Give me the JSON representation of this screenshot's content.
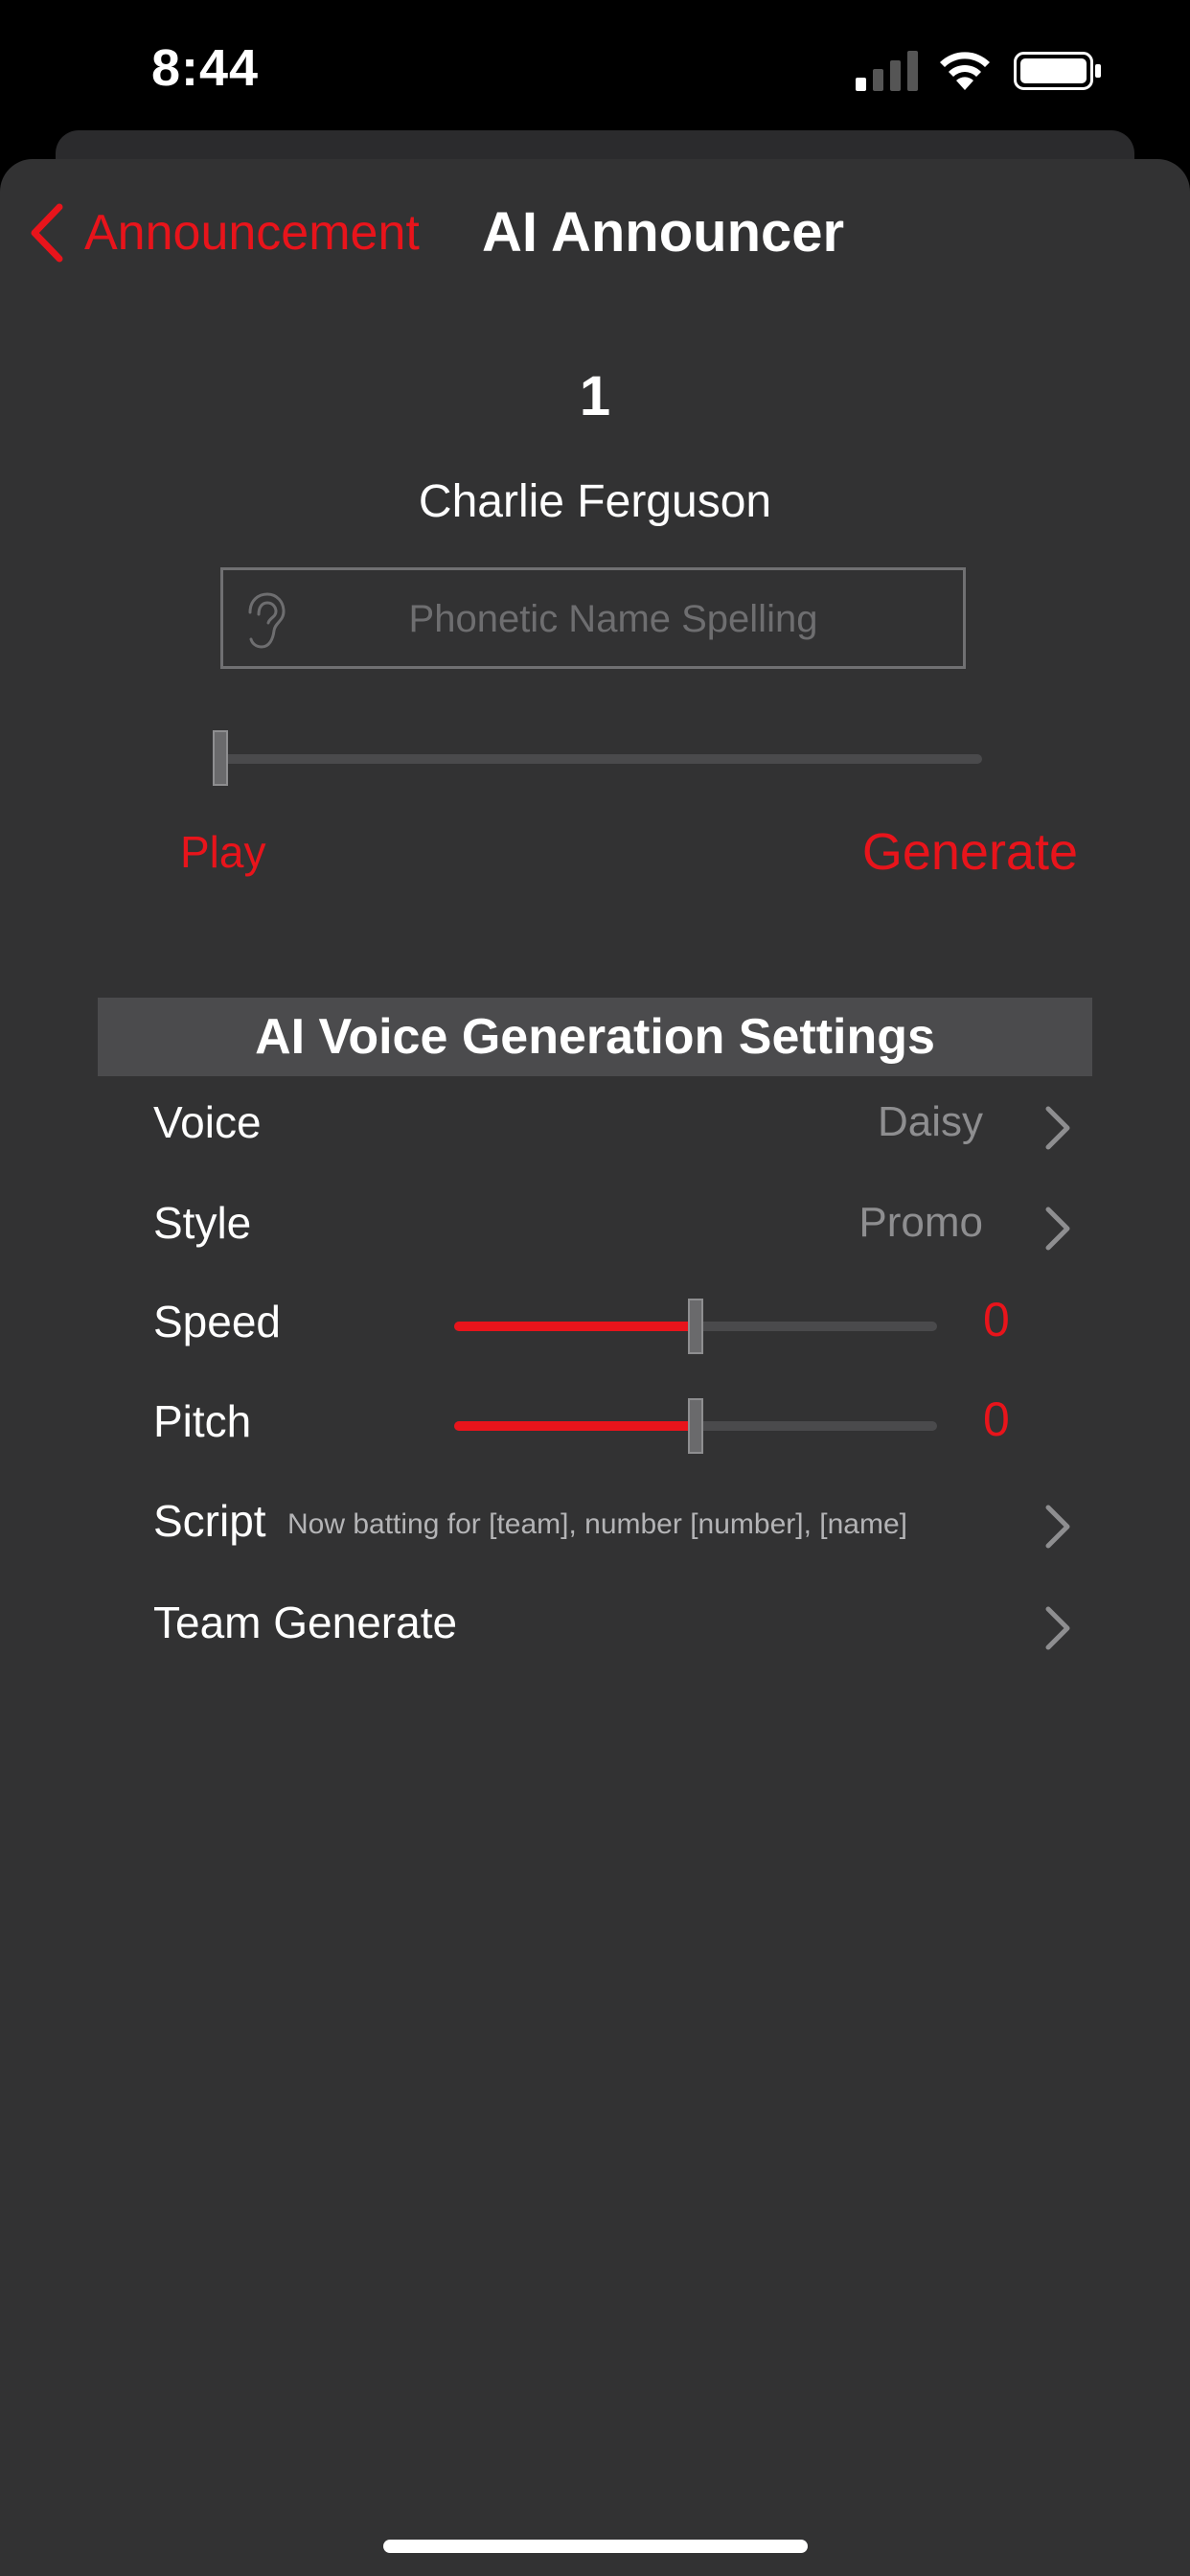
{
  "status_bar": {
    "time": "8:44"
  },
  "nav": {
    "back_label": "Announcement",
    "title": "AI Announcer"
  },
  "player": {
    "number": "1",
    "name": "Charlie Ferguson",
    "phonetic_placeholder": "Phonetic Name Spelling",
    "phonetic_value": ""
  },
  "playback": {
    "progress": 0,
    "play_label": "Play",
    "generate_label": "Generate"
  },
  "settings": {
    "header": "AI Voice Generation Settings",
    "voice": {
      "label": "Voice",
      "value": "Daisy"
    },
    "style": {
      "label": "Style",
      "value": "Promo"
    },
    "speed": {
      "label": "Speed",
      "value": "0",
      "level": 0.5
    },
    "pitch": {
      "label": "Pitch",
      "value": "0",
      "level": 0.5
    },
    "script": {
      "label": "Script",
      "value": "Now batting for [team], number [number], [name]"
    },
    "team_generate": {
      "label": "Team Generate"
    }
  },
  "colors": {
    "accent": "#e8141b",
    "background": "#323233",
    "header_bg": "#4b4b4d"
  },
  "icons": {
    "back": "chevron-left-icon",
    "ear": "ear-icon",
    "disclosure": "chevron-right-icon",
    "signal": "cellular-signal-icon",
    "wifi": "wifi-icon",
    "battery": "battery-icon"
  }
}
